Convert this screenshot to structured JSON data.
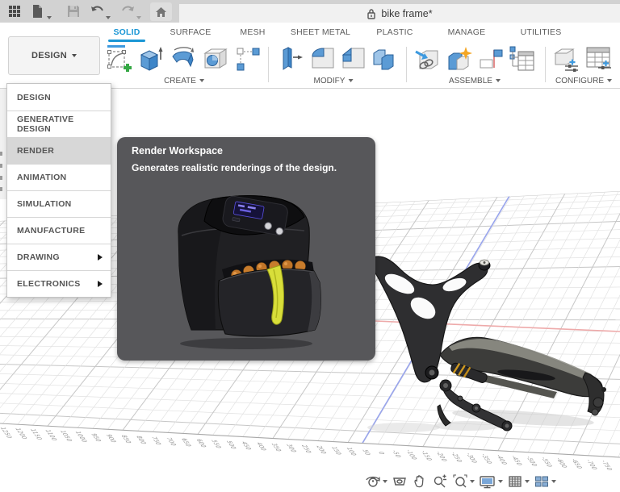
{
  "header": {
    "doc_title": "bike frame*"
  },
  "tabs": {
    "items": [
      {
        "label": "SOLID",
        "active": true
      },
      {
        "label": "SURFACE",
        "active": false
      },
      {
        "label": "MESH",
        "active": false
      },
      {
        "label": "SHEET METAL",
        "active": false
      },
      {
        "label": "PLASTIC",
        "active": false
      },
      {
        "label": "MANAGE",
        "active": false
      },
      {
        "label": "UTILITIES",
        "active": false
      }
    ]
  },
  "ribbon": {
    "workspace_button_label": "DESIGN",
    "groups": [
      {
        "label": "CREATE"
      },
      {
        "label": "MODIFY"
      },
      {
        "label": "ASSEMBLE"
      },
      {
        "label": "CONFIGURE"
      }
    ]
  },
  "workspace_menu": {
    "items": [
      {
        "label": "DESIGN"
      },
      {
        "label": "GENERATIVE DESIGN"
      },
      {
        "label": "RENDER",
        "highlighted": true
      },
      {
        "label": "ANIMATION"
      },
      {
        "label": "SIMULATION"
      },
      {
        "label": "MANUFACTURE"
      },
      {
        "label": "DRAWING",
        "has_submenu": true
      },
      {
        "label": "ELECTRONICS",
        "has_submenu": true
      }
    ]
  },
  "tooltip": {
    "title": "Render Workspace",
    "description": "Generates realistic renderings of the design."
  },
  "viewport": {
    "ruler_values": [
      1250,
      1200,
      1150,
      1100,
      1050,
      1000,
      950,
      900,
      850,
      800,
      750,
      700,
      650,
      600,
      550,
      500,
      450,
      400,
      350,
      300,
      250,
      200,
      150,
      100,
      50,
      0,
      -50,
      -100,
      -150,
      -200,
      -250,
      -300,
      -350,
      -400,
      -450,
      -500,
      -550,
      -600,
      -650,
      -700,
      -750
    ],
    "colors": {
      "grid_minor": "#e2e2e2",
      "grid_major": "#c6c6c6",
      "axis_red": "#eeaaaa",
      "axis_blue": "#98a4ec",
      "edge": "#a8a8a8",
      "ruler_text": "#909090"
    }
  },
  "nav_bar": {
    "icons": [
      "orbit",
      "look-at",
      "pan",
      "zoom",
      "fit",
      "display-settings",
      "grid-and-snaps",
      "viewports"
    ]
  }
}
